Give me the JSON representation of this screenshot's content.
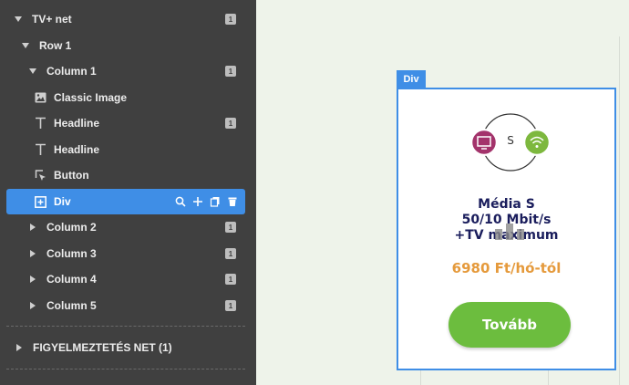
{
  "sidebar": {
    "items": [
      {
        "label": "TV+ net",
        "badge": "1"
      },
      {
        "label": "Row 1"
      },
      {
        "label": "Column 1",
        "badge": "1"
      },
      {
        "label": "Classic Image"
      },
      {
        "label": "Headline",
        "badge": "1"
      },
      {
        "label": "Headline"
      },
      {
        "label": "Button"
      },
      {
        "label": "Div"
      },
      {
        "label": "Column 2",
        "badge": "1"
      },
      {
        "label": "Column 3",
        "badge": "1"
      },
      {
        "label": "Column 4",
        "badge": "1"
      },
      {
        "label": "Column 5",
        "badge": "1"
      }
    ],
    "section": {
      "label": "FIGYELMEZTETÉS NET (1)"
    }
  },
  "canvas": {
    "div_tag": "Div",
    "card": {
      "logo_letter": "S",
      "headline": [
        "Média S",
        "50/10 Mbit/s",
        "+TV maximum"
      ],
      "price": "6980 Ft/hó-tól",
      "cta_label": "Tovább"
    }
  },
  "colors": {
    "sidebar_bg": "#404040",
    "selected_bg": "#3f8ee6",
    "headline": "#1a1d5c",
    "price": "#e59a3c",
    "cta_bg": "#6cbd3e",
    "tv_icon_bg": "#a3336b",
    "wifi_icon_bg": "#7db83e"
  }
}
